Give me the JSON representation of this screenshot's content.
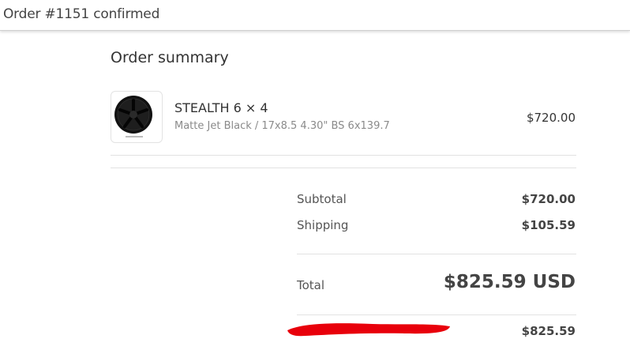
{
  "header": {
    "title": "Order #1151 confirmed"
  },
  "summary": {
    "title": "Order summary",
    "item": {
      "image_icon": "wheel-rim-image",
      "name": "STEALTH 6 × 4",
      "variant": "Matte Jet Black / 17x8.5 4.30\" BS 6x139.7",
      "price": "$720.00"
    },
    "subtotal": {
      "label": "Subtotal",
      "value": "$720.00"
    },
    "shipping": {
      "label": "Shipping",
      "value": "$105.59"
    },
    "total": {
      "label": "Total",
      "value": "$825.59 USD"
    },
    "paid": {
      "value": "$825.59",
      "redaction_color": "#e8000b"
    }
  }
}
